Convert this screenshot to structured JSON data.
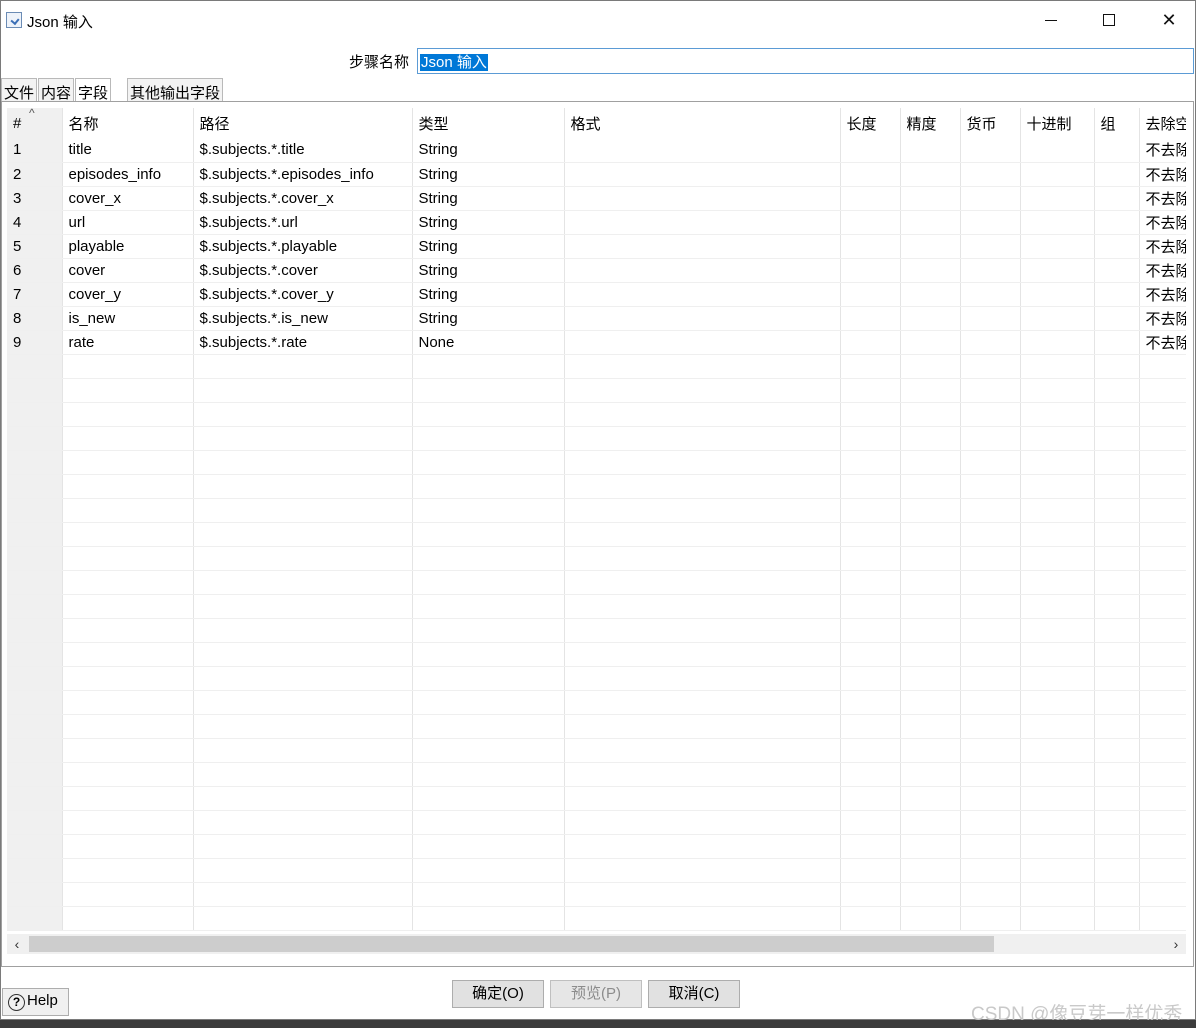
{
  "window": {
    "title": "Json 输入",
    "close_glyph": "✕"
  },
  "step": {
    "label": "步骤名称",
    "value": "Json 输入"
  },
  "tabs": [
    {
      "label": "文件",
      "active": false
    },
    {
      "label": "内容",
      "active": false
    },
    {
      "label": "字段",
      "active": true
    },
    {
      "label": "其他输出字段",
      "active": false
    }
  ],
  "table": {
    "columns": [
      "#",
      "名称",
      "路径",
      "类型",
      "格式",
      "长度",
      "精度",
      "货币",
      "十进制",
      "组",
      "去除空"
    ],
    "rows": [
      {
        "num": "1",
        "name": "title",
        "path": "$.subjects.*.title",
        "type": "String",
        "trim": "不去除空"
      },
      {
        "num": "2",
        "name": "episodes_info",
        "path": "$.subjects.*.episodes_info",
        "type": "String",
        "trim": "不去除空"
      },
      {
        "num": "3",
        "name": "cover_x",
        "path": "$.subjects.*.cover_x",
        "type": "String",
        "trim": "不去除空"
      },
      {
        "num": "4",
        "name": "url",
        "path": "$.subjects.*.url",
        "type": "String",
        "trim": "不去除空"
      },
      {
        "num": "5",
        "name": "playable",
        "path": "$.subjects.*.playable",
        "type": "String",
        "trim": "不去除空"
      },
      {
        "num": "6",
        "name": "cover",
        "path": "$.subjects.*.cover",
        "type": "String",
        "trim": "不去除空"
      },
      {
        "num": "7",
        "name": "cover_y",
        "path": "$.subjects.*.cover_y",
        "type": "String",
        "trim": "不去除空"
      },
      {
        "num": "8",
        "name": "is_new",
        "path": "$.subjects.*.is_new",
        "type": "String",
        "trim": "不去除空"
      },
      {
        "num": "9",
        "name": "rate",
        "path": "$.subjects.*.rate",
        "type": "None",
        "trim": "不去除空"
      }
    ]
  },
  "buttons": {
    "help": "Help",
    "ok": "确定(O)",
    "preview": "预览(P)",
    "cancel": "取消(C)"
  },
  "watermark": "CSDN @像豆芽一样优秀"
}
